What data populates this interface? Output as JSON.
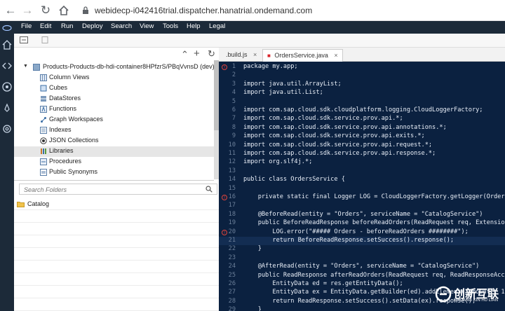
{
  "browser": {
    "url": "webidecp-i042416trial.dispatcher.hanatrial.ondemand.com"
  },
  "menu": [
    "File",
    "Edit",
    "Run",
    "Deploy",
    "Search",
    "View",
    "Tools",
    "Help",
    "Legal"
  ],
  "tree": {
    "root": "Products-Products-db-hdi-container8HPfzrS/PBqVvnsD (dev)",
    "items": [
      {
        "label": "Column Views",
        "icon": "column-views-icon"
      },
      {
        "label": "Cubes",
        "icon": "cubes-icon"
      },
      {
        "label": "DataStores",
        "icon": "datastores-icon"
      },
      {
        "label": "Functions",
        "icon": "functions-icon"
      },
      {
        "label": "Graph Workspaces",
        "icon": "graph-icon"
      },
      {
        "label": "Indexes",
        "icon": "indexes-icon"
      },
      {
        "label": "JSON Collections",
        "icon": "json-icon"
      },
      {
        "label": "Libraries",
        "icon": "libraries-icon"
      },
      {
        "label": "Procedures",
        "icon": "procedures-icon"
      },
      {
        "label": "Public Synonyms",
        "icon": "synonyms-icon"
      }
    ]
  },
  "search": {
    "placeholder": "Search Folders"
  },
  "folders": [
    {
      "label": "Catalog"
    }
  ],
  "tabs": [
    {
      "label": ".build.js"
    },
    {
      "label": "OrdersService.java"
    }
  ],
  "code": [
    {
      "n": "1",
      "t": "package my.app;",
      "err": true
    },
    {
      "n": "2",
      "t": ""
    },
    {
      "n": "3",
      "t": "import java.util.ArrayList;"
    },
    {
      "n": "4",
      "t": "import java.util.List;"
    },
    {
      "n": "5",
      "t": ""
    },
    {
      "n": "6",
      "t": "import com.sap.cloud.sdk.cloudplatform.logging.CloudLoggerFactory;"
    },
    {
      "n": "7",
      "t": "import com.sap.cloud.sdk.service.prov.api.*;"
    },
    {
      "n": "8",
      "t": "import com.sap.cloud.sdk.service.prov.api.annotations.*;"
    },
    {
      "n": "9",
      "t": "import com.sap.cloud.sdk.service.prov.api.exits.*;"
    },
    {
      "n": "10",
      "t": "import com.sap.cloud.sdk.service.prov.api.request.*;"
    },
    {
      "n": "11",
      "t": "import com.sap.cloud.sdk.service.prov.api.response.*;"
    },
    {
      "n": "12",
      "t": "import org.slf4j.*;"
    },
    {
      "n": "13",
      "t": ""
    },
    {
      "n": "14",
      "t": "public class OrdersService {"
    },
    {
      "n": "15",
      "t": ""
    },
    {
      "n": "16",
      "t": "    private static final Logger LOG = CloudLoggerFactory.getLogger(OrdersServic",
      "err": true
    },
    {
      "n": "17",
      "t": ""
    },
    {
      "n": "18",
      "t": "    @BeforeRead(entity = \"Orders\", serviceName = \"CatalogService\")"
    },
    {
      "n": "19",
      "t": "    public BeforeReadResponse beforeReadOrders(ReadRequest req, ExtensionHelper"
    },
    {
      "n": "20",
      "t": "        LOG.error(\"##### Orders - beforeReadOrders ########\");",
      "err": true
    },
    {
      "n": "21",
      "t": "        return BeforeReadResponse.setSuccess().response();",
      "hl": true
    },
    {
      "n": "22",
      "t": "    }"
    },
    {
      "n": "23",
      "t": ""
    },
    {
      "n": "24",
      "t": "    @AfterRead(entity = \"Orders\", serviceName = \"CatalogService\")"
    },
    {
      "n": "25",
      "t": "    public ReadResponse afterReadOrders(ReadRequest req, ReadResponseAccessor r"
    },
    {
      "n": "26",
      "t": "        EntityData ed = res.getEntityData();"
    },
    {
      "n": "27",
      "t": "        EntityData ex = EntityData.getBuilder(ed).addElement(\"amount\", 1000).bu"
    },
    {
      "n": "28",
      "t": "        return ReadResponse.setSuccess().setData(ex).response();"
    },
    {
      "n": "29",
      "t": "    }"
    }
  ],
  "watermark": {
    "title": "创新互联",
    "subtitle": "CHUANG XIN HU LIAN"
  }
}
